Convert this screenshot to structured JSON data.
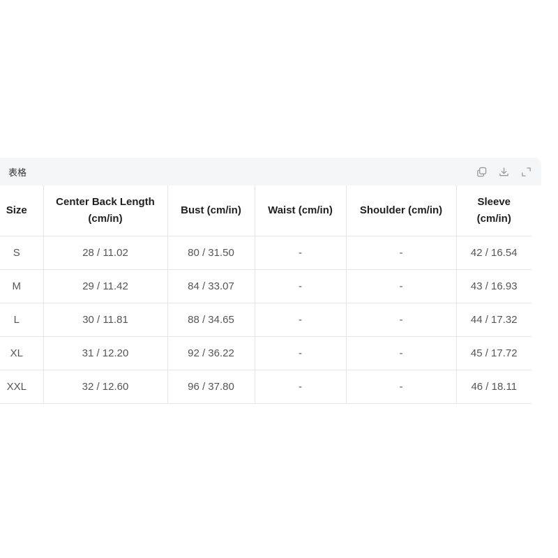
{
  "card": {
    "title": "表格",
    "actions": [
      {
        "name": "copy-icon"
      },
      {
        "name": "download-icon"
      },
      {
        "name": "expand-icon"
      }
    ]
  },
  "table": {
    "headers": [
      "Size",
      "Center Back Length (cm/in)",
      "Bust (cm/in)",
      "Waist (cm/in)",
      "Shoulder (cm/in)",
      "Sleeve (cm/in)"
    ],
    "rows": [
      [
        "S",
        "28 / 11.02",
        "80 / 31.50",
        "-",
        "-",
        "42 / 16.54"
      ],
      [
        "M",
        "29 / 11.42",
        "84 / 33.07",
        "-",
        "-",
        "43 / 16.93"
      ],
      [
        "L",
        "30 / 11.81",
        "88 / 34.65",
        "-",
        "-",
        "44 / 17.32"
      ],
      [
        "XL",
        "31 / 12.20",
        "92 / 36.22",
        "-",
        "-",
        "45 / 17.72"
      ],
      [
        "XXL",
        "32 / 12.60",
        "96 / 37.80",
        "-",
        "-",
        "46 / 18.11"
      ]
    ]
  }
}
